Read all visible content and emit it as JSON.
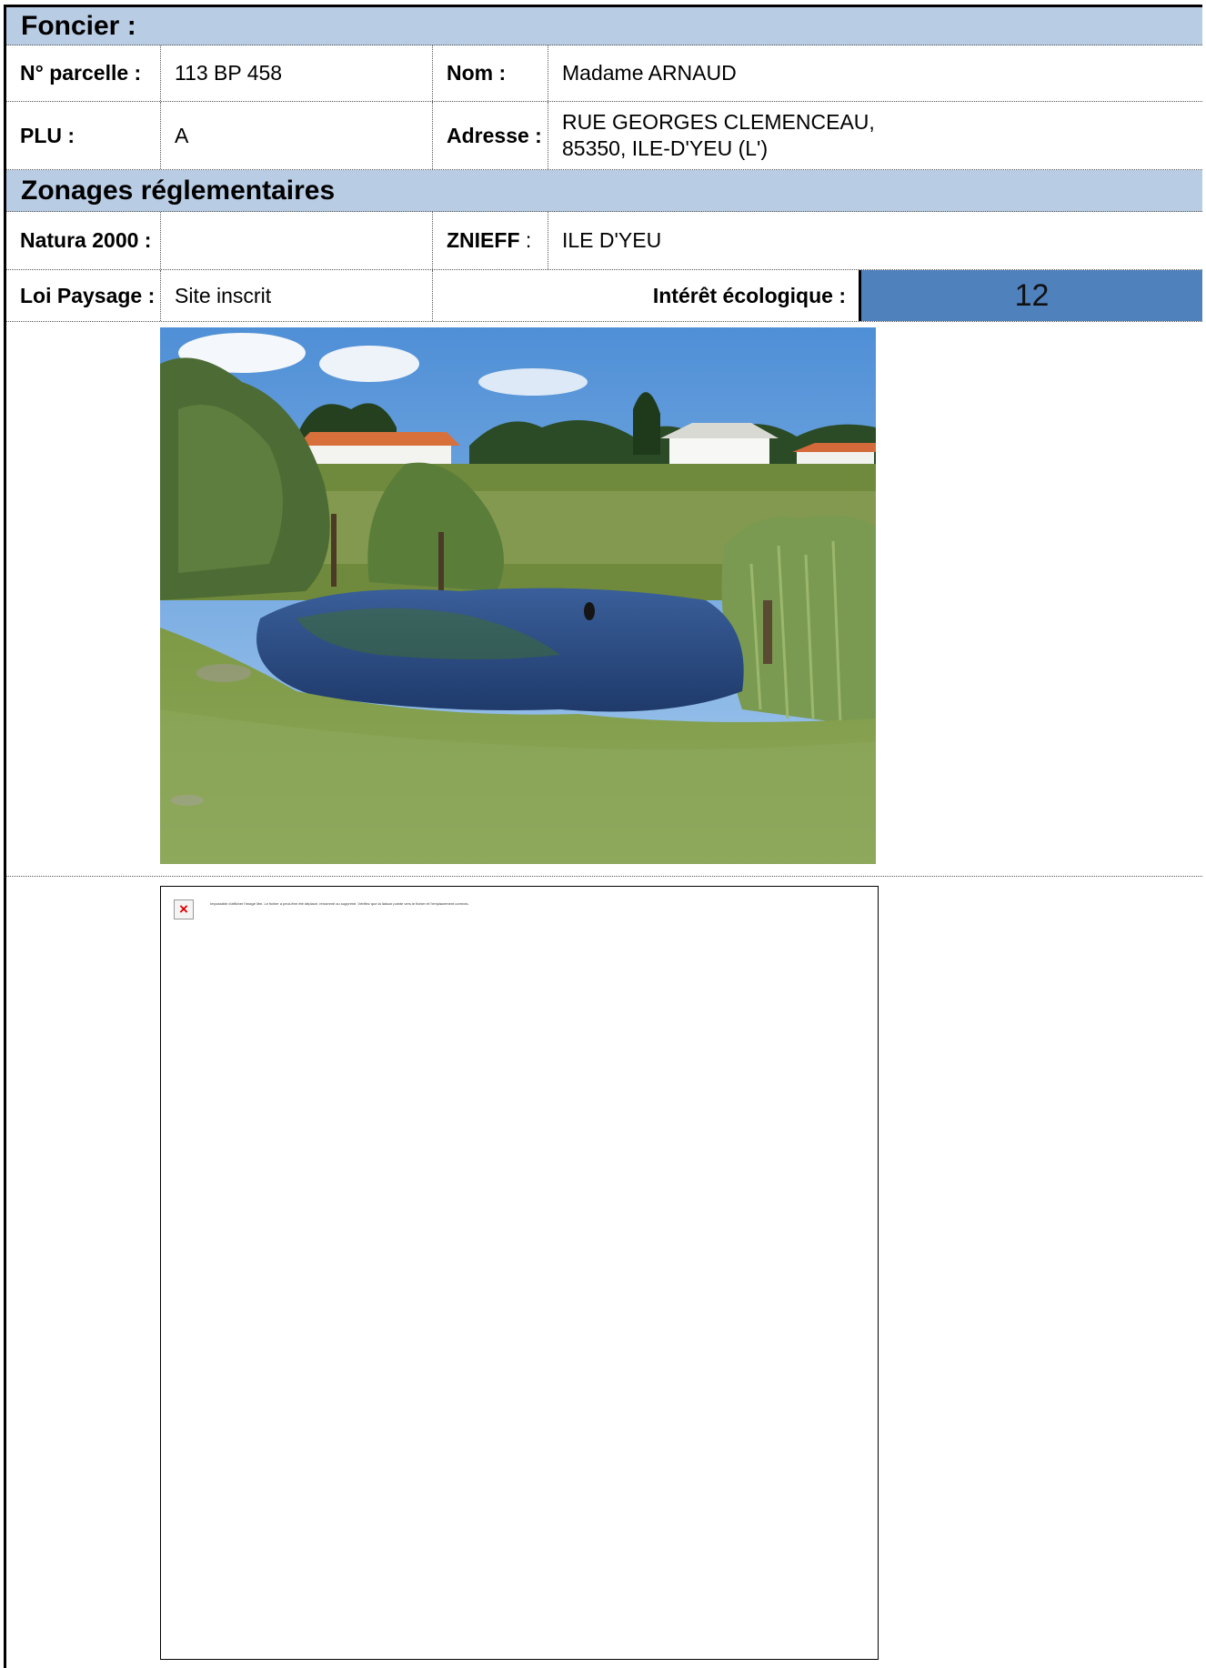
{
  "foncier": {
    "title": "Foncier :",
    "parcelle_label": "N° parcelle :",
    "parcelle_value": "113 BP 458",
    "nom_label": "Nom :",
    "nom_value": "Madame ARNAUD",
    "plu_label": "PLU :",
    "plu_value": "A",
    "adresse_label": "Adresse :",
    "adresse_line1": "RUE GEORGES CLEMENCEAU,",
    "adresse_line2": "85350, ILE-D'YEU (L')"
  },
  "zonages": {
    "title": "Zonages réglementaires",
    "natura_label": "Natura 2000 :",
    "natura_value": "",
    "znieff_label": "ZNIEFF",
    "znieff_colon": " :",
    "znieff_value": "ILE D'YEU",
    "loi_label": "Loi Paysage :",
    "loi_value": "Site inscrit",
    "interet_label": "Intérêt écologique :",
    "interet_value": "12"
  },
  "photo": {
    "description_icon": "landscape-photo-pond"
  },
  "broken_image": {
    "icon": "broken-image-icon",
    "message": "Impossible d'afficher l'image liée. Le fichier a peut-être été déplacé, renommé ou supprimé. Vérifiez que la liaison pointe vers le fichier et l'emplacement corrects."
  },
  "colors": {
    "header_band": "#b8cce4",
    "score_box": "#4f81bd"
  }
}
